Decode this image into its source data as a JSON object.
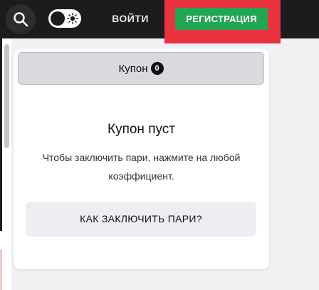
{
  "header": {
    "search_icon": "search-icon",
    "theme_toggle_icon": "sun-icon",
    "login_label": "ВОЙТИ",
    "register_label": "РЕГИСТРАЦИЯ",
    "colors": {
      "bar": "#1c1c1e",
      "register_button": "#22a652",
      "register_highlight": "#e8333e"
    }
  },
  "coupon": {
    "tab_label": "Купон",
    "tab_count": "0",
    "empty_title": "Купон пуст",
    "empty_text": "Чтобы заключить пари, нажмите на любой коэффициент.",
    "how_button_label": "КАК ЗАКЛЮЧИТЬ ПАРИ?"
  }
}
